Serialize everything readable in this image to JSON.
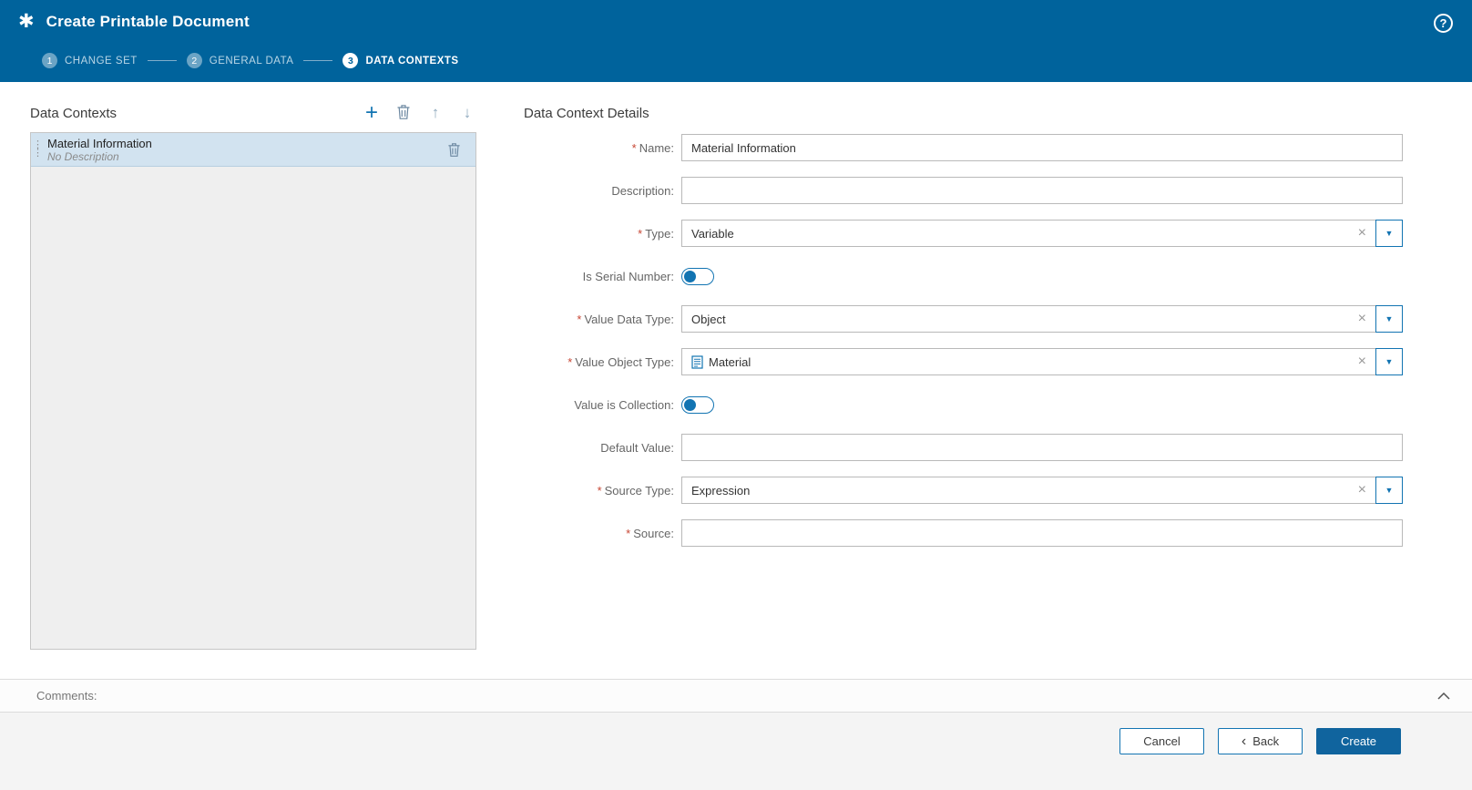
{
  "header": {
    "app_icon": "✱",
    "title": "Create Printable Document",
    "help_icon": "?"
  },
  "stepper": {
    "steps": [
      {
        "number": "1",
        "label": "CHANGE SET"
      },
      {
        "number": "2",
        "label": "GENERAL DATA"
      },
      {
        "number": "3",
        "label": "DATA CONTEXTS"
      }
    ]
  },
  "data_contexts": {
    "title": "Data Contexts",
    "toolbar": {
      "add_icon": "+",
      "delete_icon": "trash-icon",
      "move_up_icon": "↑",
      "move_down_icon": "↓"
    },
    "items": [
      {
        "name": "Material Information",
        "description": "No Description"
      }
    ]
  },
  "details": {
    "title": "Data Context Details",
    "required_marker": "*",
    "combo": {
      "clear_icon": "×",
      "caret_icon": "▼"
    },
    "fields": {
      "name": {
        "label": "Name:",
        "required": true,
        "value": "Material Information"
      },
      "description": {
        "label": "Description:",
        "required": false,
        "value": ""
      },
      "type": {
        "label": "Type:",
        "required": true,
        "value": "Variable"
      },
      "is_serial_number": {
        "label": "Is Serial Number:",
        "required": false,
        "state": "off"
      },
      "value_data_type": {
        "label": "Value Data Type:",
        "required": true,
        "value": "Object"
      },
      "value_object_type": {
        "label": "Value Object Type:",
        "required": true,
        "value": "Material",
        "icon": "document-icon"
      },
      "value_is_collection": {
        "label": "Value is Collection:",
        "required": false,
        "state": "off"
      },
      "default_value": {
        "label": "Default Value:",
        "required": false,
        "value": ""
      },
      "source_type": {
        "label": "Source Type:",
        "required": true,
        "value": "Expression"
      },
      "source": {
        "label": "Source:",
        "required": true,
        "value": ""
      }
    }
  },
  "footer": {
    "comments_label": "Comments:",
    "buttons": {
      "cancel": "Cancel",
      "back_chevron": "‹",
      "back": "Back",
      "create": "Create"
    }
  },
  "colors": {
    "header_bg": "#00639C",
    "accent": "#1274B2",
    "selected_row_bg": "#D2E3F0",
    "required_marker": "#C74634",
    "create_button_bg": "#10649E"
  }
}
